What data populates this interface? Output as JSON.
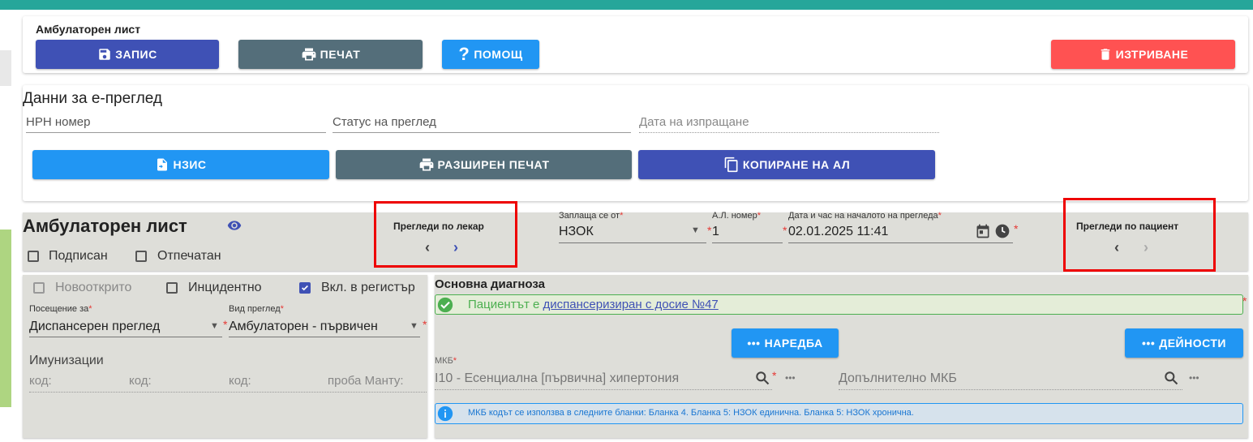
{
  "top_toolbar": {
    "title": "Амбулаторен лист",
    "save_label": "ЗАПИС",
    "print_label": "ПЕЧАТ",
    "help_label": "ПОМОЩ",
    "delete_label": "ИЗТРИВАНЕ"
  },
  "eexam": {
    "heading": "Данни за е-преглед",
    "nrn_label": "НРН номер",
    "status_label": "Статус на преглед",
    "sent_date_label": "Дата на изпращане",
    "nzis_label": "НЗИС",
    "ext_print_label": "РАЗШИРЕН ПЕЧАТ",
    "copy_label": "КОПИРАНЕ НА АЛ"
  },
  "sheet": {
    "title": "Амбулаторен лист",
    "signed_label": "Подписан",
    "printed_label": "Отпечатан",
    "by_doctor_label": "Прегледи по лекар",
    "by_patient_label": "Прегледи по пациент",
    "paid_by_label": "Заплаща се от",
    "paid_by_value": "НЗОК",
    "sheet_no_label": "А.Л. номер",
    "sheet_no_value": "1",
    "start_label": "Дата и час на началото на прегледа",
    "start_value": "02.01.2025 11:41",
    "required_mark": "*"
  },
  "left_panel": {
    "newly_found_label": "Новооткрито",
    "incidental_label": "Инцидентно",
    "registry_label": "Вкл. в регистър",
    "visit_for_label": "Посещение за",
    "visit_for_value": "Диспансерен преглед",
    "exam_type_label": "Вид преглед",
    "exam_type_value": "Амбулаторен - първичен",
    "immunizations_label": "Имунизации",
    "code1": "код:",
    "code2": "код:",
    "code3": "код:",
    "mantoux": "проба Манту:"
  },
  "diagnosis": {
    "heading": "Основна диагноза",
    "alert_prefix": "Пациентът е ",
    "alert_link": "диспансеризиран с досие №47",
    "ordinance_label": "НАРЕДБА",
    "activities_label": "ДЕЙНОСТИ",
    "mkb_label": "МКБ",
    "mkb_value": "I10 - Есенциална [първична] хипертония",
    "extra_mkb_label": "Допълнително МКБ",
    "info_text": "МКБ кодът се използва в следните бланки: Бланка 4. Бланка 5: НЗОК единична. Бланка 5: НЗОК хронична."
  },
  "colors": {
    "teal": "#26a69a",
    "indigo": "#3f51b5",
    "slate": "#546e7a",
    "blue": "#2196f3",
    "red": "#ff5252",
    "green_alert": "#4caf50"
  }
}
